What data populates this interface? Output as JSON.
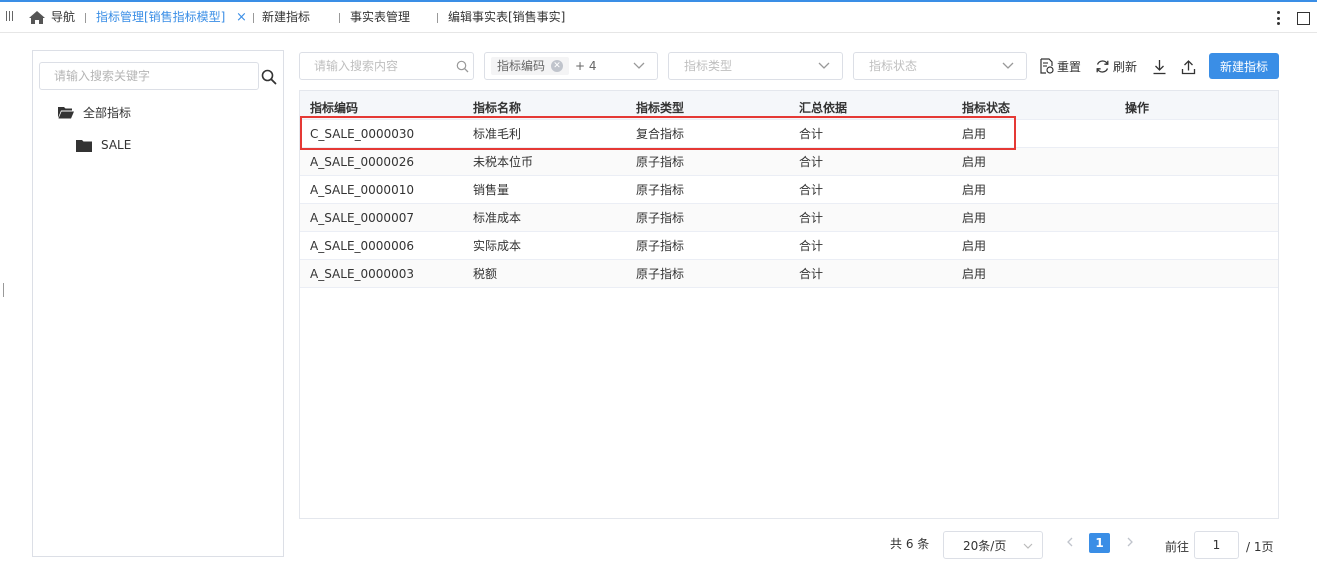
{
  "tabs": {
    "home_label": "导航",
    "items": [
      "指标管理[销售指标模型]",
      "新建指标",
      "事实表管理",
      "编辑事实表[销售事实]"
    ],
    "close_glyph": "×"
  },
  "sidebar": {
    "search_placeholder": "请输入搜索关键字",
    "tree": [
      {
        "label": "全部指标",
        "level": 0
      },
      {
        "label": "SALE",
        "level": 1
      }
    ]
  },
  "filters": {
    "search_placeholder": "请输入搜索内容",
    "code_tag": "指标编码",
    "code_more": "+ 4",
    "type_placeholder": "指标类型",
    "status_placeholder": "指标状态"
  },
  "toolbar": {
    "reset_label": "重置",
    "refresh_label": "刷新",
    "new_label": "新建指标"
  },
  "table": {
    "columns": [
      "指标编码",
      "指标名称",
      "指标类型",
      "汇总依据",
      "指标状态",
      "操作"
    ],
    "rows": [
      [
        "C_SALE_0000030",
        "标准毛利",
        "复合指标",
        "合计",
        "启用"
      ],
      [
        "A_SALE_0000026",
        "未税本位币",
        "原子指标",
        "合计",
        "启用"
      ],
      [
        "A_SALE_0000010",
        "销售量",
        "原子指标",
        "合计",
        "启用"
      ],
      [
        "A_SALE_0000007",
        "标准成本",
        "原子指标",
        "合计",
        "启用"
      ],
      [
        "A_SALE_0000006",
        "实际成本",
        "原子指标",
        "合计",
        "启用"
      ],
      [
        "A_SALE_0000003",
        "税额",
        "原子指标",
        "合计",
        "启用"
      ]
    ]
  },
  "pagination": {
    "total_text": "共 6 条",
    "page_size": "20条/页",
    "current_page": "1",
    "goto_label": "前往",
    "goto_value": "1",
    "pages_text": "/ 1页"
  },
  "colors": {
    "accent": "#3a8ee6",
    "highlight_border": "#e53935"
  }
}
